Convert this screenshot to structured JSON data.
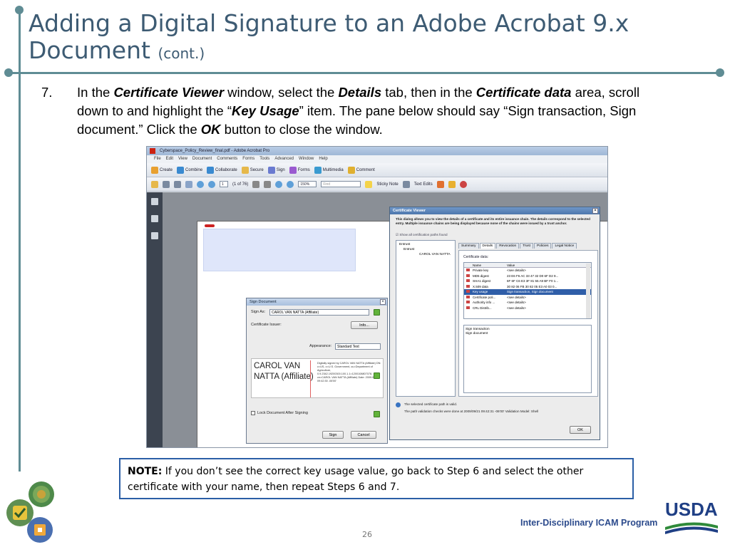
{
  "slide": {
    "title_main": "Adding a Digital Signature to an Adobe Acrobat 9.x Document",
    "title_cont": "(cont.)",
    "step_number": "7.",
    "step_text_parts": {
      "p1": "In the ",
      "b1": "Certificate Viewer",
      "p2": " window, select the ",
      "b2": "Details",
      "p3": " tab, then in the ",
      "b3": "Certificate data",
      "p4": " area, scroll down to and highlight the “",
      "b4": "Key Usage",
      "p5": "” item. The pane below should say “Sign transaction, Sign document.” Click the ",
      "b5": "OK",
      "p6": " button to close the window."
    },
    "note_label": "NOTE:",
    "note_text": " If you don’t see the correct key usage value, go back to Step 6 and select the other certificate with your name, then repeat Steps 6 and 7.",
    "page_number": "26",
    "program_name": "Inter-Disciplinary ICAM Program",
    "usda_logo_text": "USDA"
  },
  "acrobat": {
    "window_title": "Cyberspace_Policy_Review_final.pdf - Adobe Acrobat Pro",
    "menu": [
      "File",
      "Edit",
      "View",
      "Document",
      "Comments",
      "Forms",
      "Tools",
      "Advanced",
      "Window",
      "Help"
    ],
    "toolbar1": [
      "Create",
      "Combine",
      "Collaborate",
      "Secure",
      "Sign",
      "Forms",
      "Multimedia",
      "Comment"
    ],
    "page_field": "1",
    "page_of": "(1 of 76)",
    "zoom": "150%",
    "find_placeholder": "Find",
    "sticky_note": "Sticky Note",
    "text_edits": "Text Edits"
  },
  "sign_dialog": {
    "title": "Sign Document",
    "sign_as_label": "Sign As:",
    "sign_as_value": "CAROL VAN NATTA (Affiliate)",
    "cert_issuer_label": "Certificate Issuer:",
    "info_button": "Info...",
    "appearance_label": "Appearance:",
    "appearance_value": "Standard Text",
    "sig_name": "CAROL VAN NATTA (Affiliate)",
    "sig_detail": "Digitally signed by CAROL VAN NATTA (Affiliate) DN: c=US, o=U.S. Government, ou=Department of Agriculture, 0.9.2342.19200300.100.1.1=1200108807078, cn=CAROL VAN NATTA (Affiliate) Date: 2009.09.21 09:42:30 -06'00'",
    "lock_label": "Lock Document After Signing",
    "sign_button": "Sign",
    "cancel_button": "Cancel"
  },
  "cert_viewer": {
    "title": "Certificate Viewer",
    "intro": "This dialog allows you to view the details of a certificate and its entire issuance chain. The details correspond to the selected entry. Multiple issuance chains are being displayed because none of the chains were issued by a trust anchor.",
    "show_all": "Show all certification paths found",
    "tree": [
      "Entrust",
      "Entrust",
      "CAROL VAN NATTA"
    ],
    "tabs": [
      "Summary",
      "Details",
      "Revocation",
      "Trust",
      "Policies",
      "Legal Notice"
    ],
    "cert_data_label": "Certificate data:",
    "col_name": "Name",
    "col_value": "Value",
    "rows": [
      {
        "name": "Private key",
        "value": "<see details>"
      },
      {
        "name": "MD5 digest",
        "value": "23 E6 F6 AC 33 47 32 D0 6F D2 9..."
      },
      {
        "name": "SHA1 digest",
        "value": "6F 6F C6 E3 3F 81 55 A9 BF F0 1..."
      },
      {
        "name": "X.509 data",
        "value": "30 82 06 FB 30 82 05 E3 A0 03 0..."
      },
      {
        "name": "Key usage",
        "value": "Sign transaction, Sign document"
      },
      {
        "name": "Certificate poli...",
        "value": "<see details>"
      },
      {
        "name": "Authority info ...",
        "value": "<see details>"
      },
      {
        "name": "CRL Distrib...",
        "value": "<see details>"
      }
    ],
    "value_line1": "Sign transaction",
    "value_line2": "Sign document",
    "status1": "The selected certificate path is valid.",
    "status2": "The path validation checks were done at 2009/09/21 09:42:31 -06'00' Validation Model: Shell",
    "ok_button": "OK"
  }
}
